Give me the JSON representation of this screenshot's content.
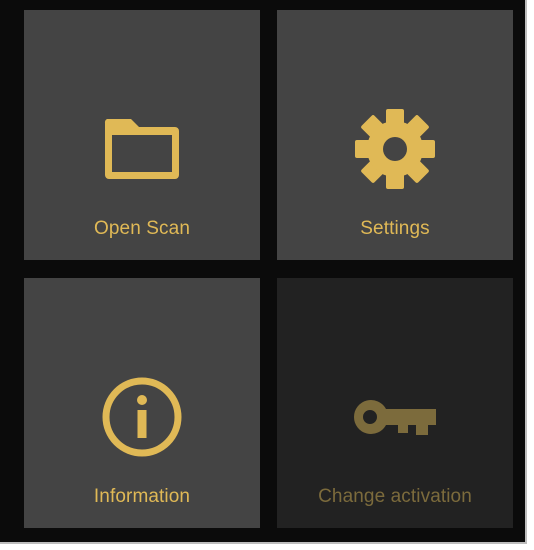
{
  "accent_color": "#e0b956",
  "disabled_accent_color": "#7c6b3c",
  "tiles": [
    {
      "label": "Open Scan",
      "icon": "folder-icon",
      "enabled": true
    },
    {
      "label": "Settings",
      "icon": "gear-icon",
      "enabled": true
    },
    {
      "label": "Information",
      "icon": "info-icon",
      "enabled": true
    },
    {
      "label": "Change activation",
      "icon": "key-icon",
      "enabled": false
    }
  ]
}
